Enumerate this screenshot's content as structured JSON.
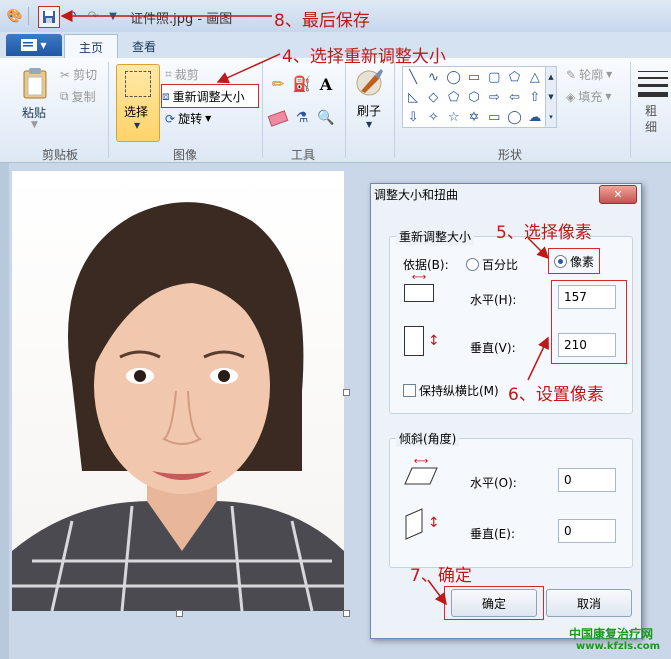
{
  "window": {
    "title": "证件照.jpg - 画图",
    "qat": [
      "paint-app-icon",
      "save-icon",
      "undo-icon",
      "redo-icon",
      "customize-icon"
    ]
  },
  "ribbon": {
    "tabs": [
      "主页",
      "查看"
    ],
    "clipboard": {
      "paste": "粘贴",
      "cut": "剪切",
      "copy": "复制",
      "label": "剪贴板"
    },
    "image": {
      "select": "选择",
      "crop": "裁剪",
      "resize": "重新调整大小",
      "rotate": "旋转",
      "label": "图像"
    },
    "tools": {
      "label": "工具"
    },
    "brushes": {
      "label": "刷子"
    },
    "shapes": {
      "outline": "轮廓",
      "fill": "填充",
      "label": "形状"
    },
    "size": {
      "label_1": "粗",
      "label_2": "细"
    }
  },
  "dialog": {
    "title": "调整大小和扭曲",
    "close": "✕",
    "resize": {
      "legend": "重新调整大小",
      "by_label": "依据(B):",
      "percent": "百分比",
      "pixels": "像素",
      "horizontal_label": "水平(H):",
      "horizontal_value": "157",
      "vertical_label": "垂直(V):",
      "vertical_value": "210",
      "keep_aspect": "保持纵横比(M)"
    },
    "skew": {
      "legend": "倾斜(角度)",
      "horizontal_label": "水平(O):",
      "horizontal_value": "0",
      "vertical_label": "垂直(E):",
      "vertical_value": "0"
    },
    "ok": "确定",
    "cancel": "取消"
  },
  "annotations": {
    "step4": "4、选择重新调整大小",
    "step5": "5、选择像素",
    "step6": "6、设置像素",
    "step7": "7、确定",
    "step8": "8、最后保存",
    "watermark_1": "中国康复治疗网",
    "watermark_2": "www.kfzls.com"
  },
  "colors": {
    "annotation": "#c01818",
    "select_button": "#ffd36a",
    "file_tab": "#1f57a3"
  }
}
